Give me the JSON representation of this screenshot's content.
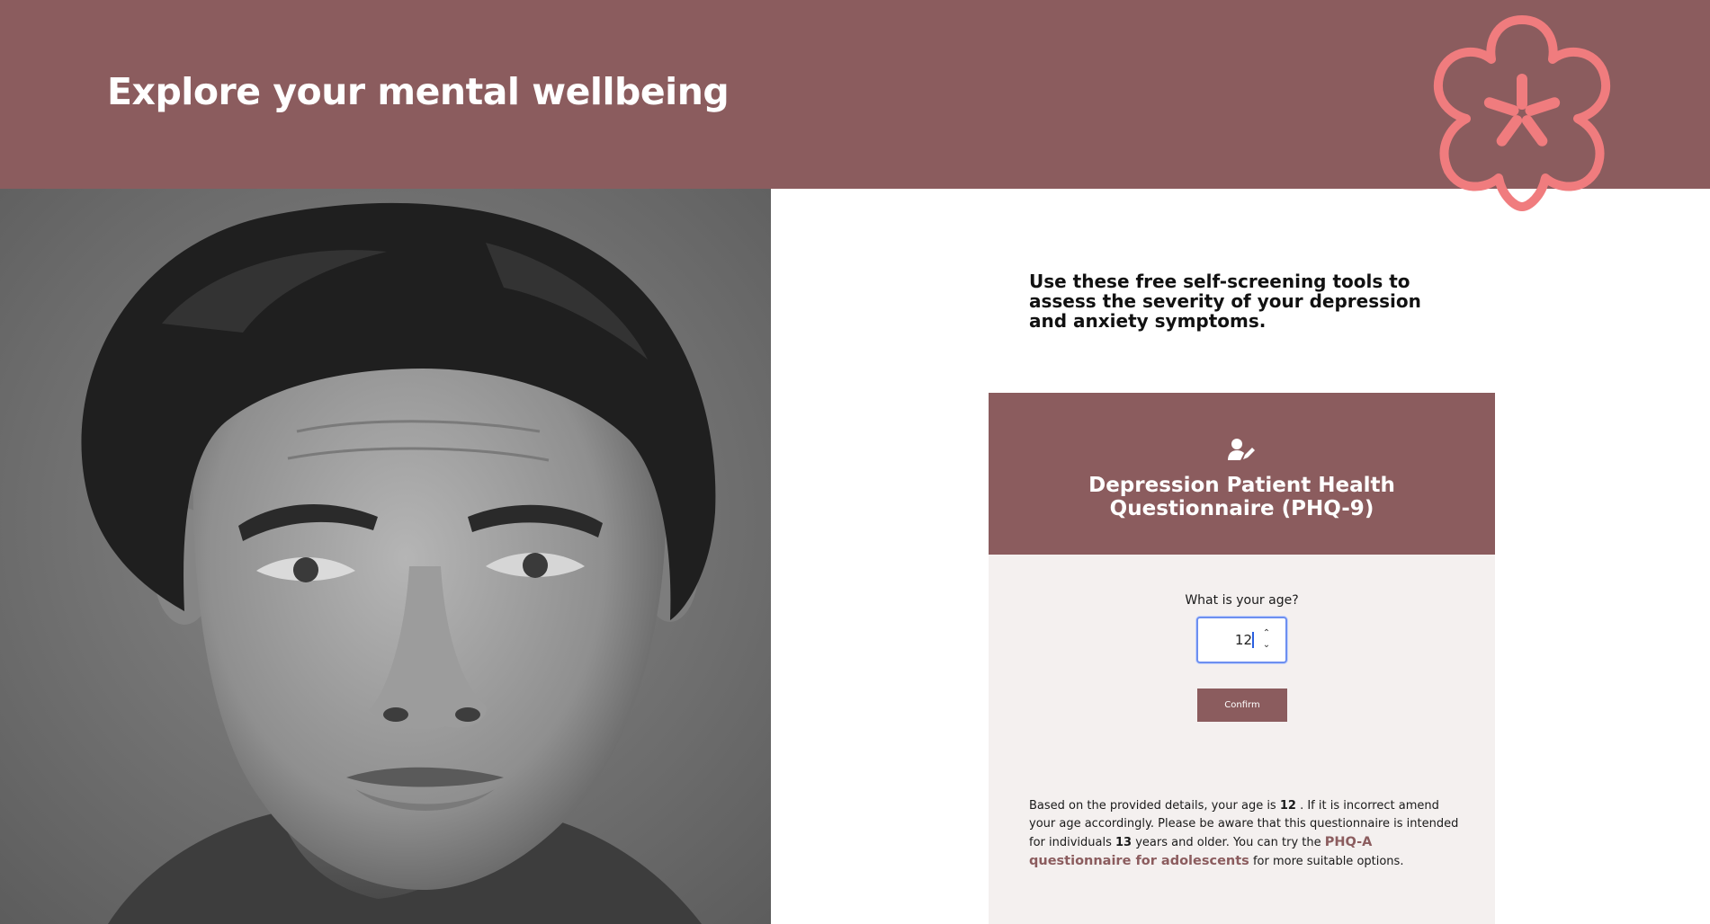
{
  "header": {
    "title": "Explore your mental wellbeing",
    "logo_icon": "flower-asterisk-icon"
  },
  "colors": {
    "brand": "#8b5c5e",
    "accent_pink": "#f07c7e",
    "card_body": "#f4f0ef",
    "focus_ring": "#6d8ff0"
  },
  "portrait": {
    "icon": "portrait-photo",
    "style": "black-and-white"
  },
  "intro": {
    "text": "Use these free self-screening tools to assess the severity of your depression and anxiety symptoms."
  },
  "card": {
    "icon": "user-edit-icon",
    "title": "Depression Patient Health Questionnaire (PHQ-9)",
    "age_label": "What is your age?",
    "age_value": "12",
    "confirm_label": "Confirm"
  },
  "notice": {
    "part1": "Based on the provided details, your age is ",
    "age": "12",
    "part2": " . If it is incorrect amend your age accordingly. Please be aware that this questionnaire is intended for individuals ",
    "min_age": "13",
    "part3": " years and older. You can try the ",
    "link_text": "PHQ-A questionnaire for adolescents",
    "part4": " for more suitable options."
  }
}
